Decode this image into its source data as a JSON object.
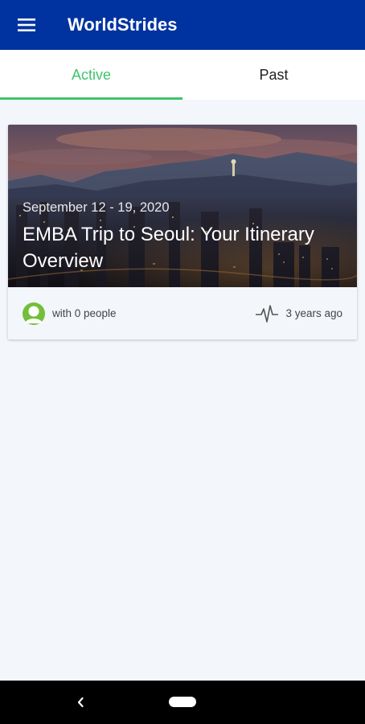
{
  "app": {
    "title": "WorldStrides",
    "menu_icon": "hamburger-menu-icon",
    "header_color": "#0033a0"
  },
  "tabs": [
    {
      "label": "Active",
      "selected": true
    },
    {
      "label": "Past",
      "selected": false
    }
  ],
  "colors": {
    "accent": "#3ec46d",
    "background": "#f3f6fa"
  },
  "trip_card": {
    "date_range": "September 12 - 19, 2020",
    "title": "EMBA Trip to Seoul: Your Itinerary Overview",
    "image": "seoul-city-skyline-dusk",
    "people_text": "with 0 people",
    "avatar_icon": "user-avatar-icon",
    "activity_icon": "activity-pulse-icon",
    "time_ago": "3 years ago"
  },
  "system_nav": {
    "back_icon": "back-chevron-icon",
    "home_icon": "home-pill-icon"
  }
}
